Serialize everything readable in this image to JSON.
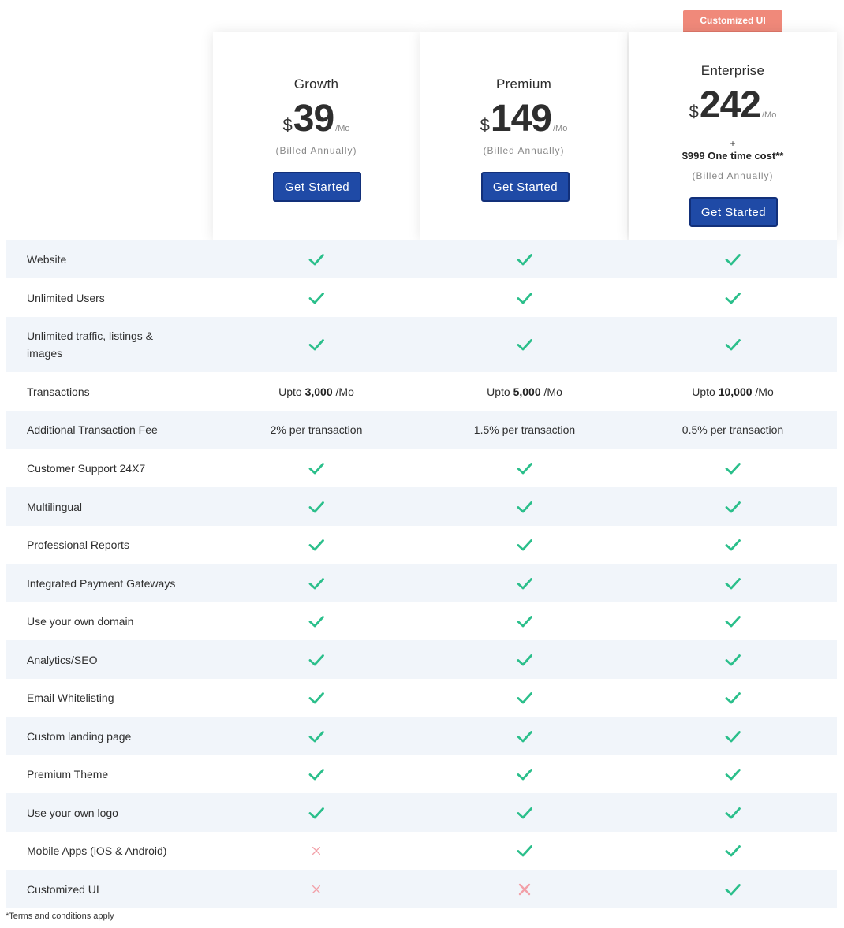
{
  "badge": "Customized UI",
  "plans": [
    {
      "name": "Growth",
      "currency": "$",
      "amount": "39",
      "period": "/Mo",
      "billed": "(Billed Annually)",
      "cta": "Get Started"
    },
    {
      "name": "Premium",
      "currency": "$",
      "amount": "149",
      "period": "/Mo",
      "billed": "(Billed Annually)",
      "cta": "Get Started"
    },
    {
      "name": "Enterprise",
      "currency": "$",
      "amount": "242",
      "period": "/Mo",
      "plus": "+",
      "extra": "$999 One time cost**",
      "billed": "(Billed Annually)",
      "cta": "Get Started"
    }
  ],
  "colors": {
    "check": "#2bbf8b",
    "cross": "#f2a0a8",
    "button": "#1f4aa6",
    "badge": "#f0897a"
  },
  "features": [
    {
      "label": "Website",
      "values": [
        "check-icon",
        "check-icon",
        "check-icon"
      ]
    },
    {
      "label": "Unlimited Users",
      "values": [
        "check-icon",
        "check-icon",
        "check-icon"
      ]
    },
    {
      "label": "Unlimited traffic, listings & images",
      "values": [
        "check-icon",
        "check-icon",
        "check-icon"
      ]
    },
    {
      "label": "Transactions",
      "values": [
        {
          "pre": "Upto ",
          "bold": "3,000",
          "post": " /Mo"
        },
        {
          "pre": "Upto ",
          "bold": "5,000",
          "post": " /Mo"
        },
        {
          "pre": "Upto ",
          "bold": "10,000",
          "post": " /Mo"
        }
      ]
    },
    {
      "label": "Additional Transaction Fee",
      "values": [
        "2% per transaction",
        "1.5% per transaction",
        "0.5% per transaction"
      ]
    },
    {
      "label": "Customer Support 24X7",
      "values": [
        "check-icon",
        "check-icon",
        "check-icon"
      ]
    },
    {
      "label": "Multilingual",
      "values": [
        "check-icon",
        "check-icon",
        "check-icon"
      ]
    },
    {
      "label": "Professional Reports",
      "values": [
        "check-icon",
        "check-icon",
        "check-icon"
      ]
    },
    {
      "label": "Integrated Payment Gateways",
      "values": [
        "check-icon",
        "check-icon",
        "check-icon"
      ]
    },
    {
      "label": "Use your own domain",
      "values": [
        "check-icon",
        "check-icon",
        "check-icon"
      ]
    },
    {
      "label": "Analytics/SEO",
      "values": [
        "check-icon",
        "check-icon",
        "check-icon"
      ]
    },
    {
      "label": "Email Whitelisting",
      "values": [
        "check-icon",
        "check-icon",
        "check-icon"
      ]
    },
    {
      "label": "Custom landing page",
      "values": [
        "check-icon",
        "check-icon",
        "check-icon"
      ]
    },
    {
      "label": "Premium Theme",
      "values": [
        "check-icon",
        "check-icon",
        "check-icon"
      ]
    },
    {
      "label": "Use your own logo",
      "values": [
        "check-icon",
        "check-icon",
        "check-icon"
      ]
    },
    {
      "label": "Mobile Apps (iOS & Android)",
      "values": [
        "cross-icon",
        "check-icon",
        "check-icon"
      ]
    },
    {
      "label": "Customized UI",
      "values": [
        "cross-icon",
        "cross-icon",
        "check-icon"
      ]
    }
  ],
  "footnote": "*Terms and conditions apply"
}
